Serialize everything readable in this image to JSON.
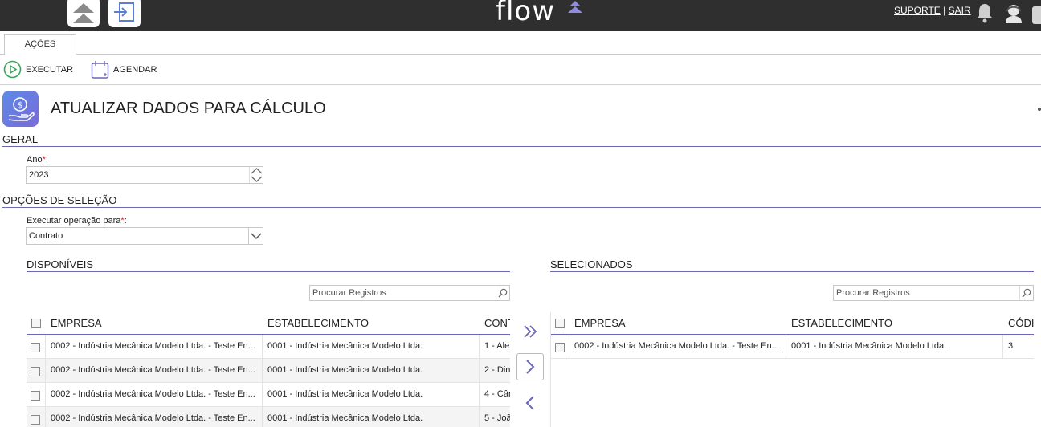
{
  "topbar": {
    "logo": "flow",
    "support_link": "SUPORTE",
    "separator": "|",
    "logout_link": "SAIR"
  },
  "tabs": [
    {
      "label": "AÇÕES"
    }
  ],
  "actions": {
    "execute_label": "EXECUTAR",
    "schedule_label": "AGENDAR"
  },
  "page": {
    "title": "ATUALIZAR DADOS PARA CÁLCULO"
  },
  "general": {
    "section_title": "GERAL",
    "year_label": "Ano",
    "year_value": "2023"
  },
  "selection": {
    "section_title": "OPÇÕES DE SELEÇÃO",
    "operation_label": "Executar operação para",
    "operation_value": "Contrato"
  },
  "available": {
    "title": "DISPONÍVEIS",
    "search_placeholder": "Procurar Registros",
    "columns": [
      "EMPRESA",
      "ESTABELECIMENTO",
      "CONT"
    ],
    "rows": [
      [
        "0002 - Indústria Mecânica Modelo Ltda. - Teste En...",
        "0001 - Indústria Mecânica Modelo Ltda.",
        "1 - Ale"
      ],
      [
        "0002 - Indústria Mecânica Modelo Ltda. - Teste En...",
        "0001 - Indústria Mecânica Modelo Ltda.",
        "2 - Din"
      ],
      [
        "0002 - Indústria Mecânica Modelo Ltda. - Teste En...",
        "0001 - Indústria Mecânica Modelo Ltda.",
        "4 - Câr"
      ],
      [
        "0002 - Indústria Mecânica Modelo Ltda. - Teste En...",
        "0001 - Indústria Mecânica Modelo Ltda.",
        "5 - Joã"
      ]
    ]
  },
  "selected": {
    "title": "SELECIONADOS",
    "search_placeholder": "Procurar Registros",
    "columns": [
      "EMPRESA",
      "ESTABELECIMENTO",
      "CÓDI"
    ],
    "rows": [
      [
        "0002 - Indústria Mecânica Modelo Ltda. - Teste En...",
        "0001 - Indústria Mecânica Modelo Ltda.",
        "3"
      ]
    ]
  },
  "colors": {
    "accent": "#6b67b5",
    "topbar": "#2f2f2f",
    "execute_green": "#3aa55a"
  }
}
